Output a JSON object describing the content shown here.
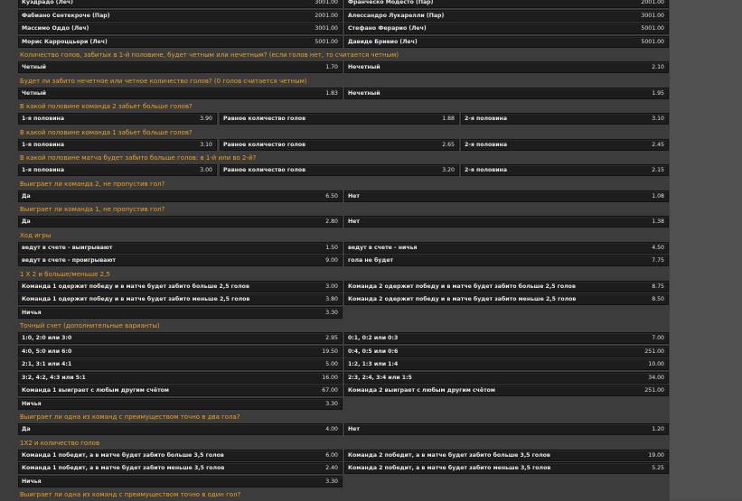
{
  "rows_top": [
    [
      {
        "label": "Куэдрадо (Леч)",
        "odd": "3001.00"
      },
      {
        "label": "Франческо Модесто (Пар)",
        "odd": "2001.00"
      }
    ],
    [
      {
        "label": "Фабиано Сентекроче (Пар)",
        "odd": "2001.00"
      },
      {
        "label": "Алессандро Лукарелли (Пар)",
        "odd": "3001.00"
      }
    ],
    [
      {
        "label": "Массимо Оддо (Леч)",
        "odd": "3001.00"
      },
      {
        "label": "Стефано Ферарио (Леч)",
        "odd": "5001.00"
      }
    ],
    [
      {
        "label": "Морис Карроццьери (Леч)",
        "odd": "5001.00"
      },
      {
        "label": "Давиде Бривио (Леч)",
        "odd": "5001.00"
      }
    ]
  ],
  "sections": [
    {
      "title": "Количество голов, забитых в 1-й половине, будет четным или нечетным? (если голов нет, то считается четным)",
      "layout": 2,
      "rows": [
        [
          {
            "label": "Четный",
            "odd": "1.70"
          },
          {
            "label": "Нечетный",
            "odd": "2.10"
          }
        ]
      ]
    },
    {
      "title": "Будет ли забито нечетное или четное количество голов? (0 голов считается четным)",
      "layout": 2,
      "rows": [
        [
          {
            "label": "Четный",
            "odd": "1.83"
          },
          {
            "label": "Нечетный",
            "odd": "1.95"
          }
        ]
      ]
    },
    {
      "title": "В какой половине команда 2 забьет больше голов?",
      "layout": 3,
      "rows": [
        [
          {
            "label": "1-я половина",
            "odd": "3.90"
          },
          {
            "label": "Равное количество голов",
            "odd": "1.88"
          },
          {
            "label": "2-я половина",
            "odd": "3.10"
          }
        ]
      ]
    },
    {
      "title": "В какой половине команда 1 забьет больше голов?",
      "layout": 3,
      "rows": [
        [
          {
            "label": "1-я половина",
            "odd": "3.10"
          },
          {
            "label": "Равное количество голов",
            "odd": "2.65"
          },
          {
            "label": "2-я половина",
            "odd": "2.45"
          }
        ]
      ]
    },
    {
      "title": "В какой половине матча будет забито больше голов: в 1-й или во 2-й?",
      "layout": 3,
      "rows": [
        [
          {
            "label": "1-я половина",
            "odd": "3.00"
          },
          {
            "label": "Равное количество голов",
            "odd": "3.20"
          },
          {
            "label": "2-я половина",
            "odd": "2.15"
          }
        ]
      ]
    },
    {
      "title": "Выиграет ли команда 2, не пропустив гол?",
      "layout": 2,
      "rows": [
        [
          {
            "label": "Да",
            "odd": "6.50"
          },
          {
            "label": "Нет",
            "odd": "1.08"
          }
        ]
      ]
    },
    {
      "title": "Выиграет ли команда 1, не пропустив гол?",
      "layout": 2,
      "rows": [
        [
          {
            "label": "Да",
            "odd": "2.80"
          },
          {
            "label": "Нет",
            "odd": "1.38"
          }
        ]
      ]
    },
    {
      "title": "Ход игры",
      "layout": 2,
      "rows": [
        [
          {
            "label": "ведут в счете - выигрывают",
            "odd": "1.50"
          },
          {
            "label": "ведут в счете - ничья",
            "odd": "4.50"
          }
        ],
        [
          {
            "label": "ведут в счете - проигрывают",
            "odd": "9.00"
          },
          {
            "label": "голa не будет",
            "odd": "7.75"
          }
        ]
      ]
    },
    {
      "title": "1 X 2 и больше/меньше 2,5",
      "layout": 2,
      "rows": [
        [
          {
            "label": "Команда 1 одержит победу и в матче будет забито больше 2,5 голов",
            "odd": "3.00"
          },
          {
            "label": "Команда 2 одержит победу и в матче будет забито больше 2,5 голов",
            "odd": "8.75"
          }
        ],
        [
          {
            "label": "Команда 1 одержит победу и в матче будет забито меньше 2,5 голов",
            "odd": "3.80"
          },
          {
            "label": "Команда 2 одержит победу и в матче будет забито меньше 2,5 голов",
            "odd": "8.50"
          }
        ],
        [
          {
            "label": "Ничья",
            "odd": "3.30"
          },
          null
        ]
      ]
    },
    {
      "title": "Точный счет (дополнительные варианты)",
      "layout": 2,
      "rows": [
        [
          {
            "label": "1:0, 2:0 или 3:0",
            "odd": "2.95"
          },
          {
            "label": "0:1, 0:2 или 0:3",
            "odd": "7.00"
          }
        ],
        [
          {
            "label": "4:0, 5:0 или 6:0",
            "odd": "19.50"
          },
          {
            "label": "0:4, 0:5 или 0:6",
            "odd": "251.00"
          }
        ],
        [
          {
            "label": "2:1, 3:1 или 4:1",
            "odd": "5.00"
          },
          {
            "label": "1:2, 1:3 или 1:4",
            "odd": "10.00"
          }
        ],
        [
          {
            "label": "3:2, 4:2, 4:3 или 5:1",
            "odd": "16.00"
          },
          {
            "label": "2:3, 2:4, 3:4 или 1:5",
            "odd": "34.00"
          }
        ],
        [
          {
            "label": "Команда 1 выиграет с любым другим счётом",
            "odd": "67.00"
          },
          {
            "label": "Команда 2 выиграет с любым другим счётом",
            "odd": "251.00"
          }
        ],
        [
          {
            "label": "Ничья",
            "odd": "3.30"
          },
          null
        ]
      ]
    },
    {
      "title": "Выиграет ли одна из команд с преимуществом точно в два гола?",
      "layout": 2,
      "rows": [
        [
          {
            "label": "Да",
            "odd": "4.00"
          },
          {
            "label": "Нет",
            "odd": "1.20"
          }
        ]
      ]
    },
    {
      "title": "1X2 и количество голов",
      "layout": 2,
      "rows": [
        [
          {
            "label": "Команда 1 победит, а в матче будет забито больше 3,5 голов",
            "odd": "6.00"
          },
          {
            "label": "Команда 2 победит, а в матче будет забито больше 3,5 голов",
            "odd": "19.00"
          }
        ],
        [
          {
            "label": "Команда 1 победит, а в матче будет забито меньше 3,5 голов",
            "odd": "2.40"
          },
          {
            "label": "Команда 2 победит, а в матче будет забито меньше 3,5 голов",
            "odd": "5.25"
          }
        ],
        [
          {
            "label": "Ничья",
            "odd": "3.30"
          },
          null
        ]
      ]
    },
    {
      "title": "Выиграет ли одна из команд с преимуществом точно в один гол?",
      "layout": 2,
      "rows": []
    }
  ]
}
